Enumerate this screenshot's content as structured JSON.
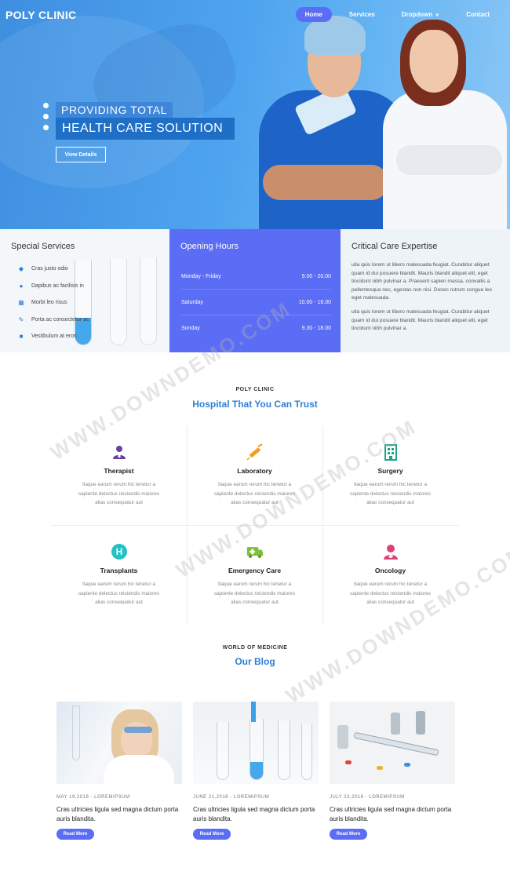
{
  "nav": {
    "brand": "POLY CLINIC",
    "items": [
      {
        "label": "Home",
        "active": true
      },
      {
        "label": "Services"
      },
      {
        "label": "Dropdown",
        "has_caret": true
      },
      {
        "label": "Contact"
      }
    ]
  },
  "hero": {
    "title_line1": "PROVIDING TOTAL",
    "title_line2": "HEALTH CARE SOLUTION",
    "button_label": "View Details",
    "slide_count": 3
  },
  "special_services": {
    "title": "Special Services",
    "items": [
      {
        "label": "Cras justo odio",
        "icon": "diamond-icon"
      },
      {
        "label": "Dapibus ac facilisis in",
        "icon": "user-icon"
      },
      {
        "label": "Morbi leo risus",
        "icon": "chart-icon"
      },
      {
        "label": "Porta ac consectetur ac",
        "icon": "pencil-icon"
      },
      {
        "label": "Vestibulum at eros",
        "icon": "truck-icon"
      }
    ]
  },
  "opening_hours": {
    "title": "Opening Hours",
    "rows": [
      {
        "day": "Monday - Friday",
        "time": "9.00 - 20.00"
      },
      {
        "day": "Saturday",
        "time": "10.00 - 16.00"
      },
      {
        "day": "Sunday",
        "time": "9.30 - 18.00"
      }
    ]
  },
  "critical_care": {
    "title": "Critical Care Expertise",
    "paragraphs": [
      "ulla quis lorem ut libero malesuada feugiat. Curabitur aliquet quam id dui posuere blandit. Mauris blandit aliquet elit, eget tincidunt nibh pulvinar a. Praesent sapien massa, convallis a pellentesque nec, egestas non nisi. Donec rutrum congue leo eget malesuada.",
      "ulla quis lorem ut libero malesuada feugiat. Curabitur aliquet quam id dui posuere blandit. Mauris blandit aliquet elit, eget tincidunt nibh pulvinar a."
    ]
  },
  "about": {
    "kicker": "POLY CLINIC",
    "title": "Hospital That You Can Trust"
  },
  "services": [
    {
      "name": "Therapist",
      "icon": "doctor-icon",
      "color": "#6b3fa0",
      "desc": "Itaque earum rerum hic tenetur a sapiente delectus reiciendis maiores alias consequatur aut"
    },
    {
      "name": "Laboratory",
      "icon": "syringe-icon",
      "color": "#f0a020",
      "desc": "Itaque earum rerum hic tenetur a sapiente delectus reiciendis maiores alias consequatur aut"
    },
    {
      "name": "Surgery",
      "icon": "hospital-icon",
      "color": "#1aa58a",
      "desc": "Itaque earum rerum hic tenetur a sapiente delectus reiciendis maiores alias consequatur aut"
    },
    {
      "name": "Transplants",
      "icon": "h-sign-icon",
      "color": "#22c1c3",
      "desc": "Itaque earum rerum hic tenetur a sapiente delectus reiciendis maiores alias consequatur aut"
    },
    {
      "name": "Emergency Care",
      "icon": "ambulance-icon",
      "color": "#7cbf3a",
      "desc": "Itaque earum rerum hic tenetur a sapiente delectus reiciendis maiores alias consequatur aut"
    },
    {
      "name": "Oncology",
      "icon": "nurse-icon",
      "color": "#e0407a",
      "desc": "Itaque earum rerum hic tenetur a sapiente delectus reiciendis maiores alias consequatur aut"
    }
  ],
  "blog": {
    "kicker": "WORLD OF MEDICINE",
    "title": "Our Blog",
    "posts": [
      {
        "meta": "MAY 19,2018 - LOREMIPSUM",
        "title": "Cras ultricies ligula sed magna dictum porta auris blandita.",
        "button": "Read More"
      },
      {
        "meta": "JUNE 21,2018 - LOREMIPSUM",
        "title": "Cras ultricies ligula sed magna dictum porta auris blandita.",
        "button": "Read More"
      },
      {
        "meta": "JULY 23,2018 - LOREMIPSUM",
        "title": "Cras ultricies ligula sed magna dictum porta auris blandita.",
        "button": "Read More"
      }
    ]
  },
  "watermark": "WWW.DOWNDEMO.COM",
  "colors": {
    "accent": "#5b6cf5",
    "heading_blue": "#2e7fd6",
    "hero_blue": "#4ea3ef"
  }
}
